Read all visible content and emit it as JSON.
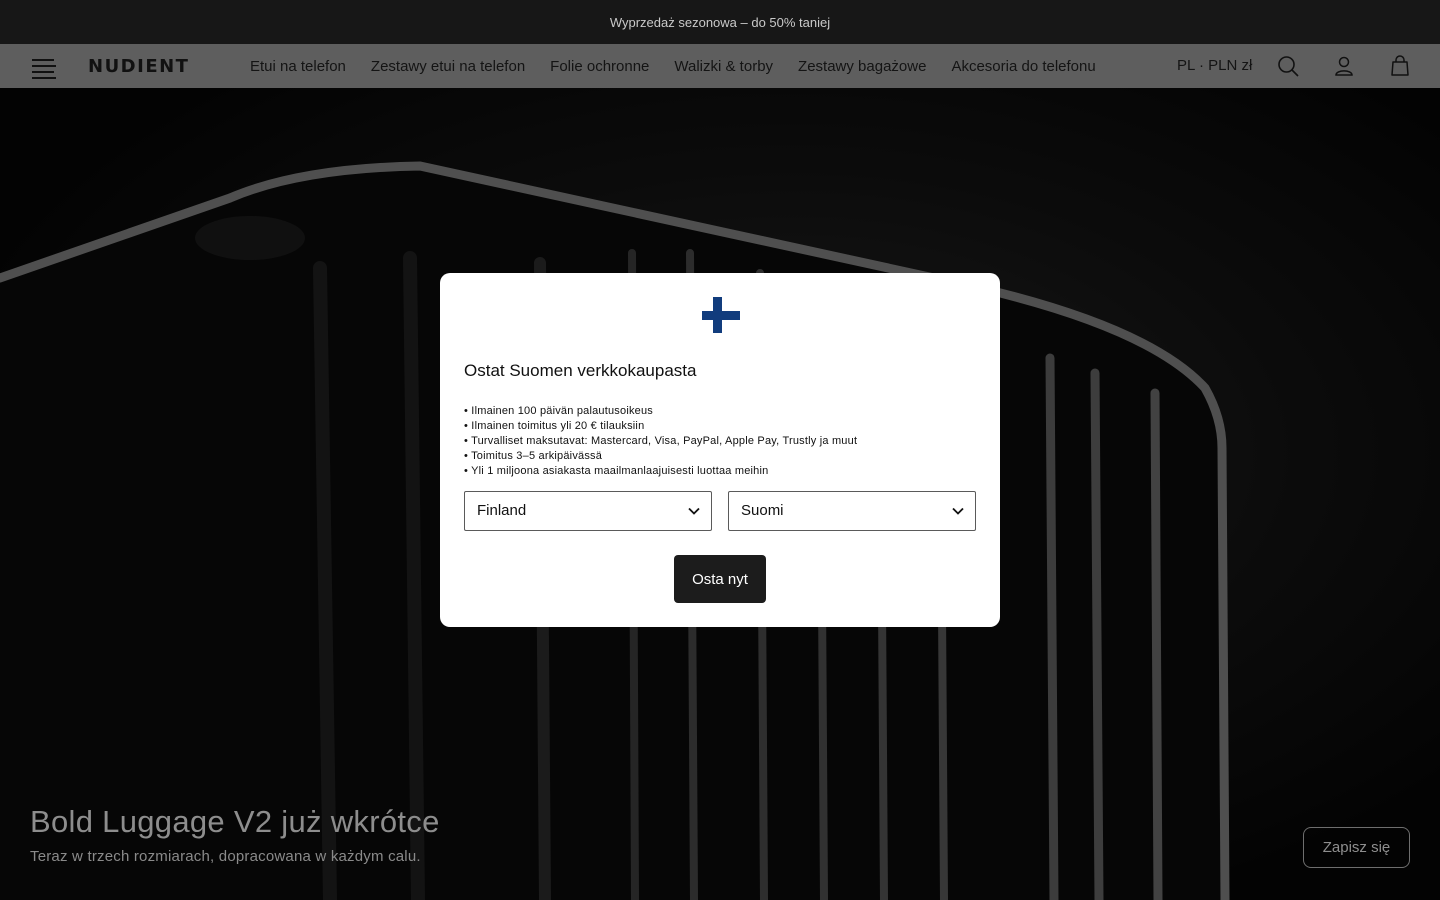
{
  "announcement": {
    "text": "Wyprzedaż sezonowa – do 50% taniej"
  },
  "header": {
    "logo": "NUDIENT",
    "nav": [
      {
        "label": "Etui na telefon"
      },
      {
        "label": "Zestawy etui na telefon"
      },
      {
        "label": "Folie ochronne"
      },
      {
        "label": "Walizki & torby"
      },
      {
        "label": "Zestawy bagażowe"
      },
      {
        "label": "Akcesoria do telefonu"
      }
    ],
    "locale": "PL · PLN zł",
    "icons": [
      "menu-icon",
      "search-icon",
      "account-icon",
      "bag-icon"
    ]
  },
  "hero": {
    "title": "Bold Luggage V2 już wkrótce",
    "subtitle": "Teraz w trzech rozmiarach, dopracowana w każdym calu.",
    "cta_label": "Zapisz się"
  },
  "modal": {
    "flag_icon": "finland-flag-icon",
    "title": "Ostat Suomen verkkokaupasta",
    "benefits": [
      "• Ilmainen 100 päivän palautusoikeus",
      "• Ilmainen toimitus yli 20 € tilauksiin",
      "• Turvalliset maksutavat: Mastercard, Visa, PayPal, Apple Pay, Trustly ja muut",
      "• Toimitus 3–5 arkipäivässä",
      "• Yli 1 miljoona asiakasta maailmanlaajuisesti luottaa meihin"
    ],
    "country_select": {
      "value": "Finland"
    },
    "language_select": {
      "value": "Suomi"
    },
    "shop_button_label": "Osta nyt"
  },
  "colors": {
    "announcement_bg": "#171717",
    "navbar_bg": "#5e5e5e",
    "modal_bg": "#ffffff",
    "button_bg": "#1c1c1c",
    "flag_blue": "#113c7d"
  }
}
